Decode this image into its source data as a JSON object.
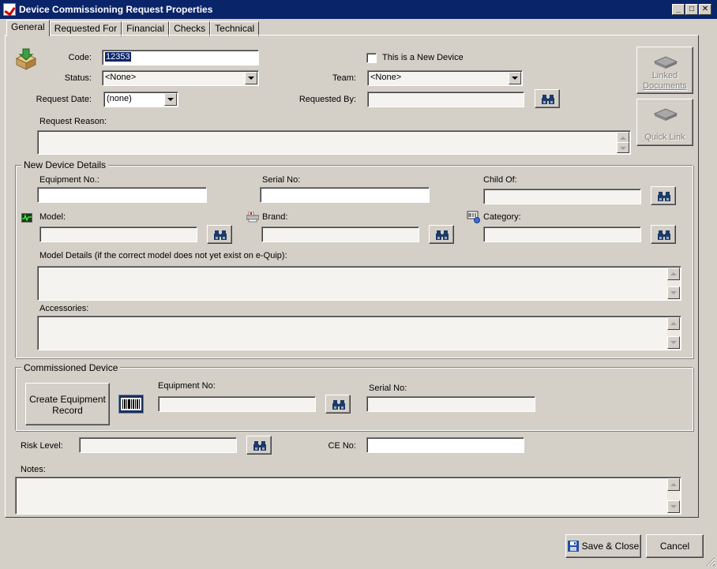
{
  "window": {
    "title": "Device Commissioning Request  Properties"
  },
  "tabs": [
    {
      "label": "General"
    },
    {
      "label": "Requested For"
    },
    {
      "label": "Financial"
    },
    {
      "label": "Checks"
    },
    {
      "label": "Technical"
    }
  ],
  "general": {
    "code_label": "Code:",
    "code_value": "12353",
    "new_device_label": "This is a New Device",
    "new_device_checked": false,
    "status_label": "Status:",
    "status_value": "<None>",
    "team_label": "Team:",
    "team_value": "<None>",
    "request_date_label": "Request Date:",
    "request_date_value": "(none)",
    "requested_by_label": "Requested By:",
    "requested_by_value": "",
    "request_reason_label": "Request Reason:",
    "request_reason_value": ""
  },
  "side_buttons": {
    "linked_documents_line1": "Linked",
    "linked_documents_line2": "Documents",
    "quick_link": "Quick Link"
  },
  "new_device": {
    "title": "New Device Details",
    "equipment_no_label": "Equipment No.:",
    "serial_no_label": "Serial No:",
    "child_of_label": "Child Of:",
    "model_label": "Model:",
    "brand_label": "Brand:",
    "category_label": "Category:",
    "model_details_label": "Model Details (if the correct model does not yet exist on e-Quip):",
    "accessories_label": "Accessories:"
  },
  "commissioned": {
    "title": "Commissioned Device",
    "create_button_line1": "Create Equipment",
    "create_button_line2": "Record",
    "equipment_no_label": "Equipment No:",
    "serial_no_label": "Serial No:"
  },
  "bottom": {
    "risk_level_label": "Risk Level:",
    "ce_no_label": "CE No:",
    "notes_label": "Notes:"
  },
  "footer": {
    "save_close": "Save & Close",
    "cancel": "Cancel"
  },
  "colors": {
    "titlebar": "#0a246a",
    "face": "#d4d0c8"
  }
}
